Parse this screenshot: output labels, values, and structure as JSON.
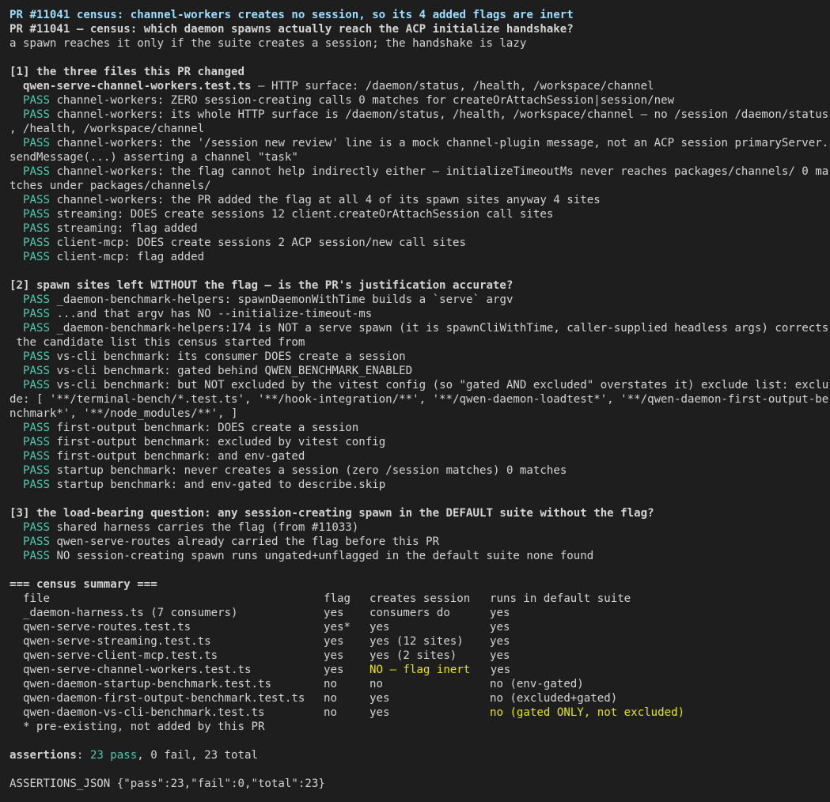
{
  "window": {
    "title_line": "PR #11041 census: channel-workers creates no session, so its 4 added flags are inert",
    "subtitle_line": "PR #11041 — census: which daemon spawns actually reach the ACP initialize handshake?",
    "intro_line": "a spawn reaches it only if the suite creates a session; the handshake is lazy"
  },
  "section1": {
    "heading": "[1] the three files this PR changed",
    "file_name": "qwen-serve-channel-workers.test.ts",
    "file_note": " — HTTP surface: /daemon/status, /health, /workspace/channel",
    "pass_label": "PASS",
    "results": [
      "channel-workers: ZERO session-creating calls 0 matches for createOrAttachSession|session/new",
      "channel-workers: its whole HTTP surface is /daemon/status, /health, /workspace/channel — no /session /daemon/status",
      "channel-workers: the '/session new review' line is a mock channel-plugin message, not an ACP session primaryServer.",
      "channel-workers: the flag cannot help indirectly either — initializeTimeoutMs never reaches packages/channels/ 0 ma",
      "channel-workers: the PR added the flag at all 4 of its spawn sites anyway 4 sites",
      "streaming: DOES create sessions 12 client.createOrAttachSession call sites",
      "streaming: flag added",
      "client-mcp: DOES create sessions 2 ACP session/new call sites",
      "client-mcp: flag added"
    ],
    "wraps": {
      "1": ", /health, /workspace/channel",
      "2": "sendMessage(...) asserting a channel \"task\"",
      "3": "tches under packages/channels/"
    }
  },
  "section2": {
    "heading": "[2] spawn sites left WITHOUT the flag — is the PR's justification accurate?",
    "results": [
      "_daemon-benchmark-helpers: spawnDaemonWithTime builds a `serve` argv",
      "...and that argv has NO --initialize-timeout-ms",
      "_daemon-benchmark-helpers:174 is NOT a serve spawn (it is spawnCliWithTime, caller-supplied headless args) corrects",
      "vs-cli benchmark: its consumer DOES create a session",
      "vs-cli benchmark: gated behind QWEN_BENCHMARK_ENABLED",
      "vs-cli benchmark: but NOT excluded by the vitest config (so \"gated AND excluded\" overstates it) exclude list: exclu",
      "first-output benchmark: DOES create a session",
      "first-output benchmark: excluded by vitest config",
      "first-output benchmark: and env-gated",
      "startup benchmark: never creates a session (zero /session matches) 0 matches",
      "startup benchmark: and env-gated to describe.skip"
    ],
    "wraps": {
      "2": [
        " the candidate list this census started from"
      ],
      "5": [
        "de: [ '**/terminal-bench/*.test.ts', '**/hook-integration/**', '**/qwen-daemon-loadtest*', '**/qwen-daemon-first-output-be",
        "nchmark*', '**/node_modules/**', ]"
      ]
    }
  },
  "section3": {
    "heading": "[3] the load-bearing question: any session-creating spawn in the DEFAULT suite without the flag?",
    "results": [
      "shared harness carries the flag (from #11033)",
      "qwen-serve-routes already carried the flag before this PR",
      "NO session-creating spawn runs ungated+unflagged in the default suite none found"
    ]
  },
  "summary": {
    "heading": "=== census summary ===",
    "columns": [
      "file",
      "flag",
      "creates session",
      "runs in default suite"
    ],
    "rows": [
      {
        "file": "_daemon-harness.ts (7 consumers)",
        "flag": "yes",
        "creates": "consumers do",
        "runs": "yes"
      },
      {
        "file": "qwen-serve-routes.test.ts",
        "flag": "yes*",
        "creates": "yes",
        "runs": "yes"
      },
      {
        "file": "qwen-serve-streaming.test.ts",
        "flag": "yes",
        "creates": "yes (12 sites)",
        "runs": "yes"
      },
      {
        "file": "qwen-serve-client-mcp.test.ts",
        "flag": "yes",
        "creates": "yes (2 sites)",
        "runs": "yes"
      },
      {
        "file": "qwen-serve-channel-workers.test.ts",
        "flag": "yes",
        "creates": "NO — flag inert",
        "runs": "yes"
      },
      {
        "file": "qwen-daemon-startup-benchmark.test.ts",
        "flag": "no",
        "creates": "no",
        "runs": "no (env-gated)"
      },
      {
        "file": "qwen-daemon-first-output-benchmark.test.ts",
        "flag": "no",
        "creates": "yes",
        "runs": "no (excluded+gated)"
      },
      {
        "file": "qwen-daemon-vs-cli-benchmark.test.ts",
        "flag": "no",
        "creates": "yes",
        "runs": "no (gated ONLY, not excluded)"
      }
    ],
    "footnote": "* pre-existing, not added by this PR"
  },
  "assertions": {
    "label": "assertions",
    "pass_text": "23 pass",
    "rest_text": ", 0 fail, 23 total",
    "json_line": "ASSERTIONS_JSON {\"pass\":23,\"fail\":0,\"total\":23}"
  },
  "colors": {
    "background": "#1e1e1e",
    "foreground": "#d4d4d4",
    "title": "#9cdcfe",
    "pass": "#4ec9b0",
    "warning": "#e5e510"
  }
}
